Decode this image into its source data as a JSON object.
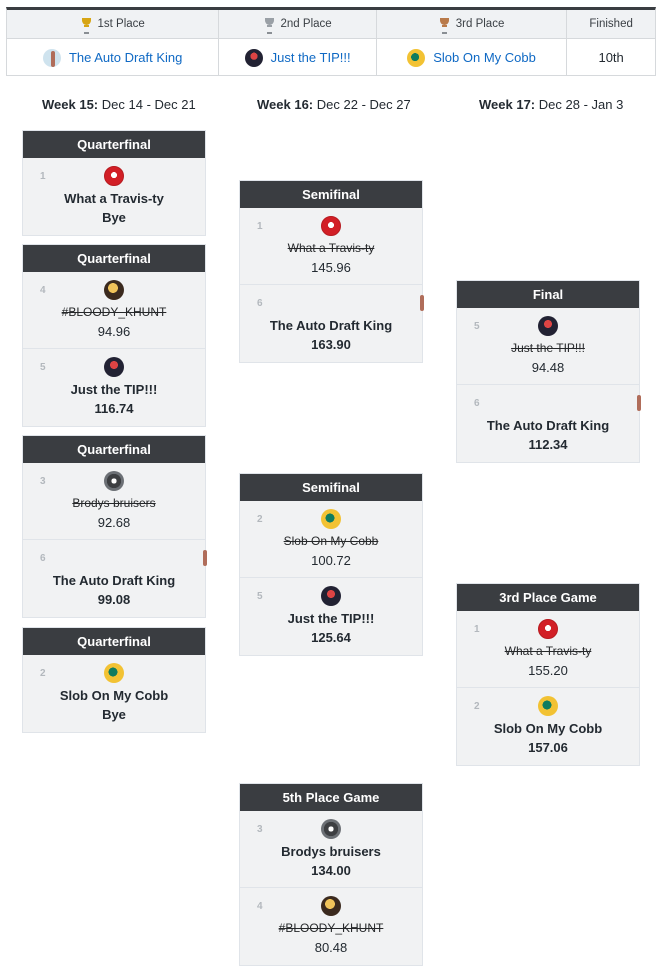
{
  "summary": {
    "headers": [
      {
        "label": "1st Place",
        "trophy": "gold"
      },
      {
        "label": "2nd Place",
        "trophy": "silver"
      },
      {
        "label": "3rd Place",
        "trophy": "bronze"
      },
      {
        "label": "Finished"
      }
    ],
    "values": [
      {
        "team": "The Auto Draft King",
        "avatar": "thin-avatar"
      },
      {
        "team": "Just the TIP!!!",
        "avatar": "tip-avatar"
      },
      {
        "team": "Slob On My Cobb",
        "avatar": "helmet-avatar"
      },
      {
        "text": "10th"
      }
    ]
  },
  "weeks": [
    {
      "label": "Week 15:",
      "dates": "Dec 14 - Dec 21"
    },
    {
      "label": "Week 16:",
      "dates": "Dec 22 - Dec 27"
    },
    {
      "label": "Week 17:",
      "dates": "Dec 28 - Jan 3"
    }
  ],
  "matches": {
    "qf1": {
      "title": "Quarterfinal",
      "slots": [
        {
          "seed": "1",
          "name": "What a Travis-ty",
          "score": "Bye",
          "avatar": "chiefs",
          "loser": false
        }
      ]
    },
    "qf2": {
      "title": "Quarterfinal",
      "slots": [
        {
          "seed": "4",
          "name": "#BLOODY_KHUNT",
          "score": "94.96",
          "avatar": "bloody",
          "loser": true
        },
        {
          "seed": "5",
          "name": "Just the TIP!!!",
          "score": "116.74",
          "avatar": "tip",
          "loser": false
        }
      ]
    },
    "qf3": {
      "title": "Quarterfinal",
      "slots": [
        {
          "seed": "3",
          "name": "Brodys bruisers",
          "score": "92.68",
          "avatar": "gear",
          "loser": true
        },
        {
          "seed": "6",
          "name": "The Auto Draft King",
          "score": "99.08",
          "avatar": "thin",
          "loser": false
        }
      ]
    },
    "qf4": {
      "title": "Quarterfinal",
      "slots": [
        {
          "seed": "2",
          "name": "Slob On My Cobb",
          "score": "Bye",
          "avatar": "helmet",
          "loser": false
        }
      ]
    },
    "sf1": {
      "title": "Semifinal",
      "slots": [
        {
          "seed": "1",
          "name": "What a Travis-ty",
          "score": "145.96",
          "avatar": "chiefs",
          "loser": true
        },
        {
          "seed": "6",
          "name": "The Auto Draft King",
          "score": "163.90",
          "avatar": "thin",
          "loser": false
        }
      ]
    },
    "sf2": {
      "title": "Semifinal",
      "slots": [
        {
          "seed": "2",
          "name": "Slob On My Cobb",
          "score": "100.72",
          "avatar": "helmet",
          "loser": true
        },
        {
          "seed": "5",
          "name": "Just the TIP!!!",
          "score": "125.64",
          "avatar": "tip",
          "loser": false
        }
      ]
    },
    "fifth": {
      "title": "5th Place Game",
      "slots": [
        {
          "seed": "3",
          "name": "Brodys bruisers",
          "score": "134.00",
          "avatar": "gear",
          "loser": false
        },
        {
          "seed": "4",
          "name": "#BLOODY_KHUNT",
          "score": "80.48",
          "avatar": "bloody",
          "loser": true
        }
      ]
    },
    "final": {
      "title": "Final",
      "slots": [
        {
          "seed": "5",
          "name": "Just the TIP!!!",
          "score": "94.48",
          "avatar": "tip",
          "loser": true
        },
        {
          "seed": "6",
          "name": "The Auto Draft King",
          "score": "112.34",
          "avatar": "thin",
          "loser": false
        }
      ]
    },
    "third": {
      "title": "3rd Place Game",
      "slots": [
        {
          "seed": "1",
          "name": "What a Travis-ty",
          "score": "155.20",
          "avatar": "chiefs",
          "loser": true
        },
        {
          "seed": "2",
          "name": "Slob On My Cobb",
          "score": "157.06",
          "avatar": "helmet",
          "loser": false
        }
      ]
    }
  }
}
